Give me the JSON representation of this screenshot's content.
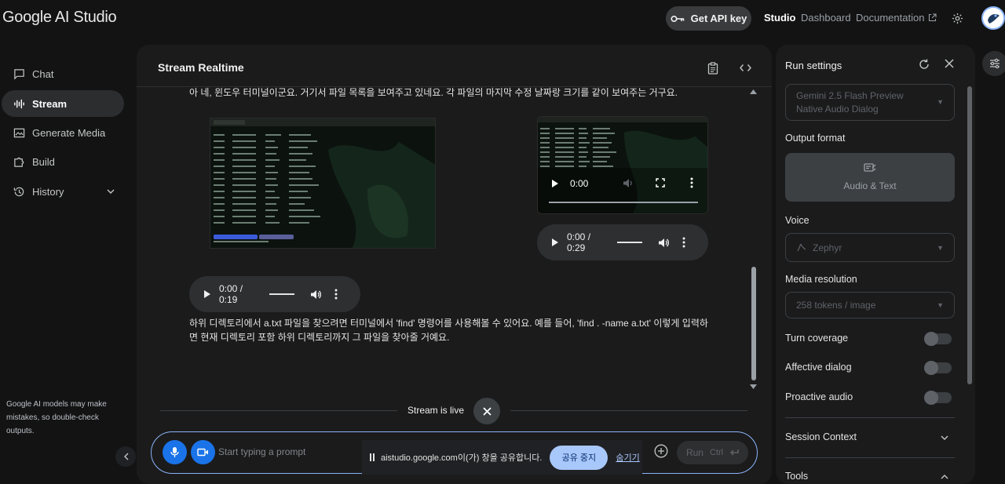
{
  "header": {
    "logo": "Google AI Studio",
    "api_key_label": "Get API key",
    "nav": {
      "studio": "Studio",
      "dashboard": "Dashboard",
      "documentation": "Documentation"
    }
  },
  "sidebar": {
    "items": [
      {
        "label": "Chat",
        "icon": "chat-icon"
      },
      {
        "label": "Stream",
        "icon": "waveform-icon",
        "active": true
      },
      {
        "label": "Generate Media",
        "icon": "image-icon"
      },
      {
        "label": "Build",
        "icon": "puzzle-icon"
      },
      {
        "label": "History",
        "icon": "history-icon"
      }
    ],
    "disclaimer": "Google AI models may make mistakes, so double-check outputs."
  },
  "main": {
    "title": "Stream Realtime",
    "message_1": "아 네, 윈도우 터미널이군요. 거기서 파일 목록을 보여주고 있네요. 각 파일의 마지막 수정 날짜랑 크기를 같이 보여주는 거구요.",
    "video_time": "0:00",
    "audio_1_time": "0:00 / 0:29",
    "audio_2_time": "0:00 / 0:19",
    "message_2": "하위 디렉토리에서 a.txt 파일을 찾으려면 터미널에서 'find' 명령어를 사용해볼 수 있어요. 예를 들어, 'find . -name a.txt' 이렇게 입력하면 현재 디렉토리 포함 하위 디렉토리까지 그 파일을 찾아줄 거예요.",
    "stream_status": "Stream is live"
  },
  "prompt": {
    "placeholder": "Start typing a prompt",
    "run_label": "Run",
    "run_shortcut": "Ctrl"
  },
  "share_bar": {
    "text": "aistudio.google.com이(가) 창을 공유합니다.",
    "stop_label": "공유 중지",
    "hide_label": "숨기기"
  },
  "run_settings": {
    "title": "Run settings",
    "model": "Gemini 2.5 Flash Preview Native Audio Dialog",
    "output_format_label": "Output format",
    "output_format_value": "Audio & Text",
    "voice_label": "Voice",
    "voice_value": "Zephyr",
    "media_resolution_label": "Media resolution",
    "media_resolution_value": "258 tokens / image",
    "toggles": [
      {
        "label": "Turn coverage",
        "on": false
      },
      {
        "label": "Affective dialog",
        "on": false
      },
      {
        "label": "Proactive audio",
        "on": false
      }
    ],
    "session_context_label": "Session Context",
    "tools_label": "Tools"
  },
  "colors": {
    "accent": "#8ab4f8",
    "button_blue": "#1a73e8",
    "share_stop": "#a8c7fa"
  }
}
